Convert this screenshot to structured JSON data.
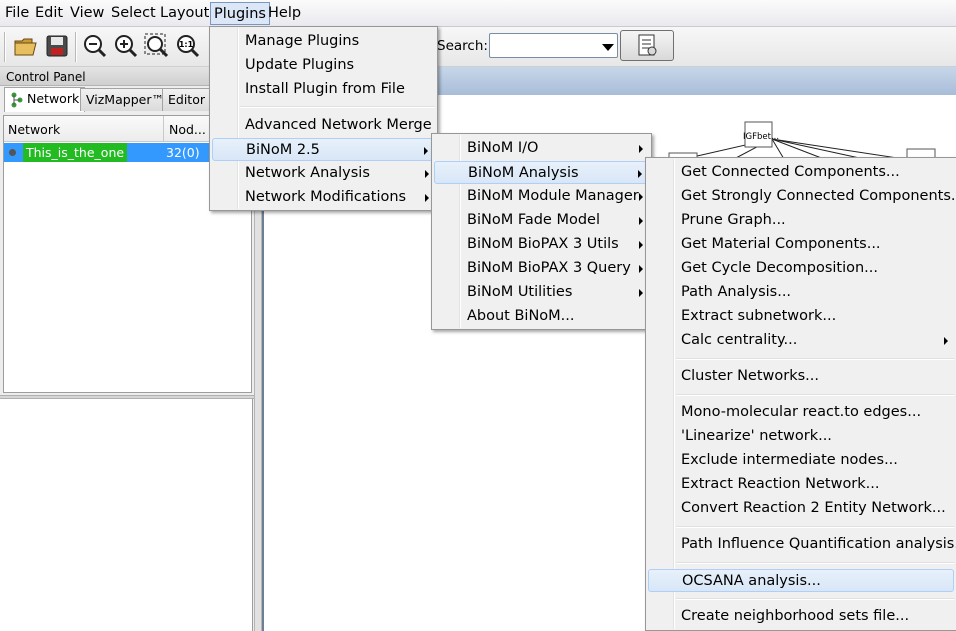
{
  "menubar": {
    "items": [
      "File",
      "Edit",
      "View",
      "Select",
      "Layout",
      "Plugins",
      "Help"
    ],
    "open_index": 5
  },
  "toolbar": {
    "icons": [
      "open-folder-icon",
      "save-icon",
      "zoom-out-icon",
      "zoom-in-icon",
      "zoom-fit-icon",
      "zoom-actual-icon"
    ],
    "search_label": "Search:",
    "search_value": "",
    "search_options_icon": "search-options-icon"
  },
  "control_panel": {
    "title": "Control Panel",
    "tabs": [
      "Network",
      "VizMapper™",
      "Editor"
    ],
    "active_tab": "Network",
    "columns": [
      "Network",
      "Nod..."
    ],
    "networks": [
      {
        "name": "This_is_the_one",
        "count": "32(0)"
      }
    ]
  },
  "network_view": {
    "node_label": "IGFbet..."
  },
  "plugins_menu": {
    "items": [
      {
        "label": "Manage Plugins"
      },
      {
        "label": "Update Plugins"
      },
      {
        "label": "Install Plugin from File"
      },
      {
        "label": "Advanced Network Merge"
      },
      {
        "label": "BiNoM 2.5",
        "submenu": true,
        "highlighted": true
      },
      {
        "label": "Network Analysis",
        "submenu": true
      },
      {
        "label": "Network Modifications",
        "submenu": true
      }
    ]
  },
  "binom_menu": {
    "items": [
      {
        "label": "BiNoM I/O",
        "submenu": true
      },
      {
        "label": "BiNoM Analysis",
        "submenu": true,
        "highlighted": true
      },
      {
        "label": "BiNoM Module Manager",
        "submenu": true
      },
      {
        "label": "BiNoM Fade Model",
        "submenu": true
      },
      {
        "label": "BiNoM BioPAX 3 Utils",
        "submenu": true
      },
      {
        "label": "BiNoM BioPAX 3 Query",
        "submenu": true
      },
      {
        "label": "BiNoM Utilities",
        "submenu": true
      },
      {
        "label": "About BiNoM..."
      }
    ]
  },
  "analysis_menu": {
    "items": [
      {
        "label": "Get Connected Components..."
      },
      {
        "label": "Get Strongly Connected Components..."
      },
      {
        "label": "Prune Graph..."
      },
      {
        "label": "Get Material Components..."
      },
      {
        "label": "Get Cycle Decomposition..."
      },
      {
        "label": "Path Analysis..."
      },
      {
        "label": "Extract subnetwork..."
      },
      {
        "label": "Calc centrality...",
        "submenu": true
      },
      {
        "label": "Cluster Networks..."
      },
      {
        "label": "Mono-molecular react.to edges..."
      },
      {
        "label": "'Linearize' network..."
      },
      {
        "label": "Exclude intermediate nodes..."
      },
      {
        "label": "Extract Reaction Network..."
      },
      {
        "label": "Convert Reaction 2 Entity Network..."
      },
      {
        "label": "Path Influence Quantification analysis..."
      },
      {
        "label": "OCSANA analysis...",
        "highlighted": true
      },
      {
        "label": "Create neighborhood sets file..."
      }
    ]
  },
  "colors": {
    "selection_blue": "#3399ff",
    "network_green": "#22bb22",
    "menu_highlight": "#d8e6f7"
  }
}
